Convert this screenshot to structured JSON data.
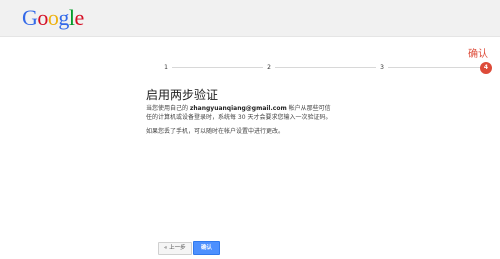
{
  "header": {
    "logo_letters": [
      "G",
      "o",
      "o",
      "g",
      "l",
      "e"
    ],
    "logo_colors": [
      "#3369e8",
      "#d50f25",
      "#eeb211",
      "#3369e8",
      "#009925",
      "#d50f25"
    ]
  },
  "wizard": {
    "current_step_label": "确认",
    "steps": [
      "1",
      "2",
      "3",
      "4"
    ],
    "active_step": 4,
    "accent_color": "#dd4b39"
  },
  "main": {
    "title": "启用两步验证",
    "para1_prefix": "当您使用自己的 ",
    "para1_email": "zhangyuanqiang@gmail.com",
    "para1_suffix": " 帐户从那些可信任的计算机或设备登录时，系统每 30 天才会要求您输入一次验证码。",
    "para2": "如果您丢了手机，可以随时在帐户设置中进行更改。"
  },
  "buttons": {
    "prev_label": "« 上一步",
    "confirm_label": "确认"
  }
}
